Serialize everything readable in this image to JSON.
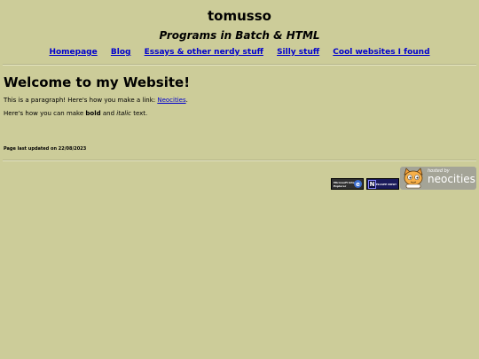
{
  "header": {
    "site_title": "tomusso",
    "subtitle": "Programs in Batch & HTML"
  },
  "nav": {
    "items": [
      {
        "label": "Homepage"
      },
      {
        "label": "Blog"
      },
      {
        "label": "Essays & other nerdy stuff"
      },
      {
        "label": "Silly stuff"
      },
      {
        "label": "Cool websites I found"
      }
    ]
  },
  "main": {
    "heading": "Welcome to my Website!",
    "p1_prefix": "This is a paragraph! Here's how you make a link: ",
    "p1_link": "Neocities",
    "p1_suffix": ".",
    "p2_prefix": "Here's how you can make ",
    "p2_bold": "bold",
    "p2_middle": " and ",
    "p2_italic": "italic",
    "p2_suffix": " text.",
    "updated": "Page last updated on 22/08/2023"
  },
  "badges": {
    "ie_text": "Microsoft Internet Explorer",
    "ie_logo": "e",
    "ns_logo": "N",
    "ns_text": "NETSCAPE NOW!",
    "neo_hosted": "hosted by",
    "neo_name": "neocities"
  },
  "icons": {
    "ie": "internet-explorer-logo-icon",
    "netscape": "netscape-logo-icon",
    "neocities": "neocities-cat-icon"
  },
  "colors": {
    "background": "#cccc99",
    "link": "#0000cc"
  }
}
